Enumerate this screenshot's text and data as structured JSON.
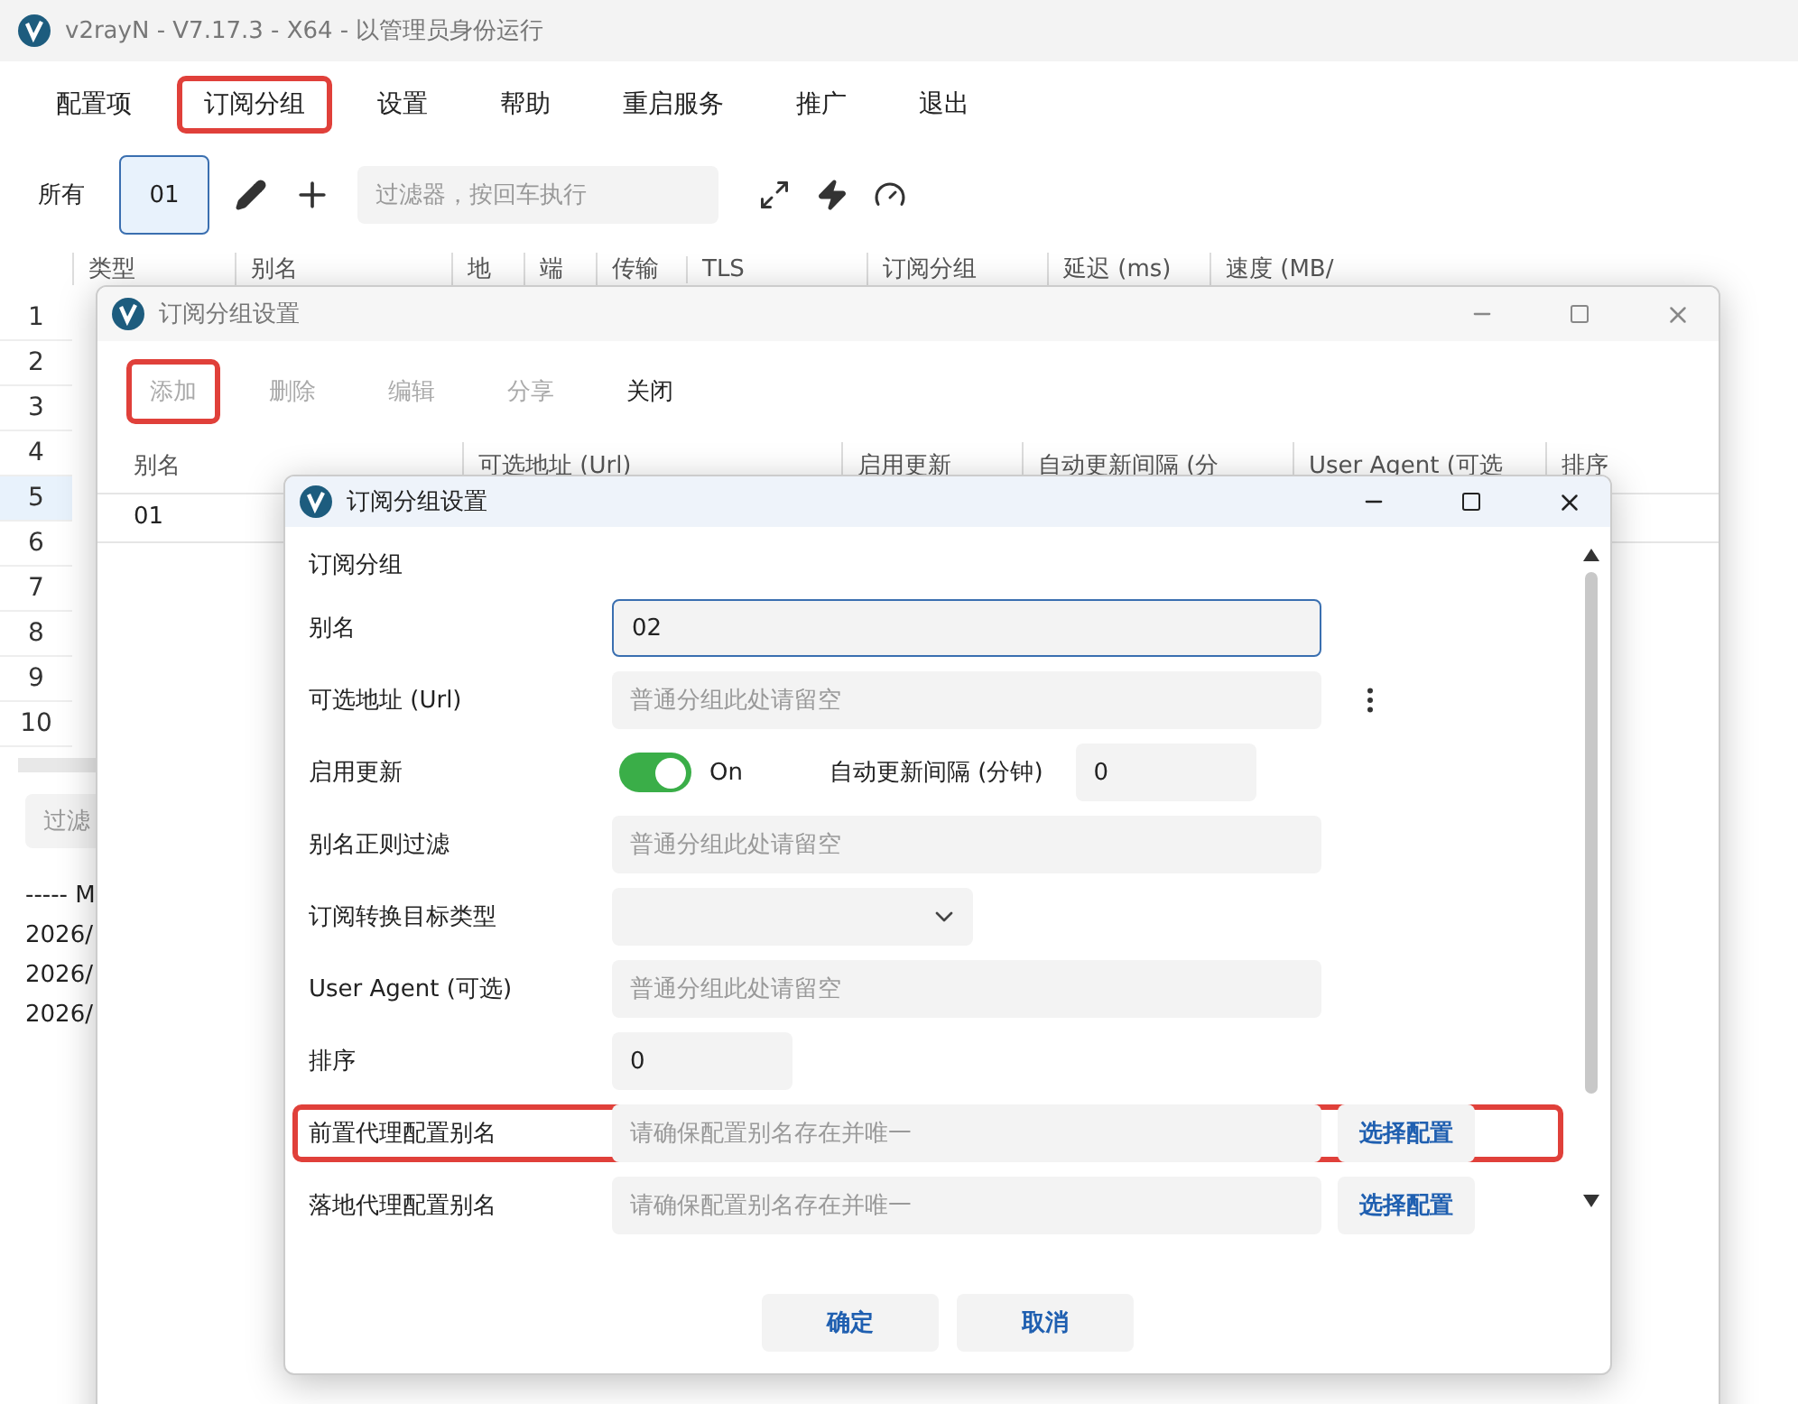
{
  "window": {
    "title": "v2rayN - V7.17.3 - X64 - 以管理员身份运行"
  },
  "menu": [
    {
      "label": "配置项",
      "highlighted": false
    },
    {
      "label": "订阅分组",
      "highlighted": true
    },
    {
      "label": "设置",
      "highlighted": false
    },
    {
      "label": "帮助",
      "highlighted": false
    },
    {
      "label": "重启服务",
      "highlighted": false
    },
    {
      "label": "推广",
      "highlighted": false
    },
    {
      "label": "退出",
      "highlighted": false
    }
  ],
  "groups": [
    {
      "label": "所有",
      "selected": false
    },
    {
      "label": "01",
      "selected": true
    }
  ],
  "filter": {
    "placeholder": "过滤器，按回车执行"
  },
  "table": {
    "columns": [
      "类型",
      "别名",
      "地",
      "端",
      "传输",
      "TLS",
      "订阅分组",
      "延迟 (ms)",
      "速度 (MB/"
    ],
    "rows": [
      {
        "number": "1",
        "selected": false
      },
      {
        "number": "2",
        "selected": false
      },
      {
        "number": "3",
        "selected": false
      },
      {
        "number": "4",
        "selected": false
      },
      {
        "number": "5",
        "selected": true
      },
      {
        "number": "6",
        "selected": false
      },
      {
        "number": "7",
        "selected": false
      },
      {
        "number": "8",
        "selected": false
      },
      {
        "number": "9",
        "selected": false
      },
      {
        "number": "10",
        "selected": false
      }
    ]
  },
  "log": {
    "filter_placeholder": "过滤",
    "lines": [
      "----- M",
      "2026/",
      "2026/",
      "2026/"
    ]
  },
  "group_dialog": {
    "title": "订阅分组设置",
    "toolbar": [
      {
        "label": "添加",
        "disabled": true,
        "highlighted": true
      },
      {
        "label": "删除",
        "disabled": true,
        "highlighted": false
      },
      {
        "label": "编辑",
        "disabled": true,
        "highlighted": false
      },
      {
        "label": "分享",
        "disabled": true,
        "highlighted": false
      },
      {
        "label": "关闭",
        "disabled": false,
        "highlighted": false
      }
    ],
    "columns": [
      "别名",
      "可选地址 (Url)",
      "启用更新",
      "自动更新间隔 (分",
      "User Agent (可选",
      "排序"
    ],
    "rows": [
      [
        "01"
      ]
    ]
  },
  "edit_dialog": {
    "title": "订阅分组设置",
    "section": "订阅分组",
    "fields": [
      {
        "kind": "text",
        "label": "别名",
        "value": "02",
        "focused": true,
        "highlighted": false
      },
      {
        "kind": "more",
        "label": "可选地址 (Url)",
        "placeholder": "普通分组此处请留空",
        "highlighted": false
      },
      {
        "kind": "toggle",
        "label": "启用更新",
        "on": true,
        "state_label": "On",
        "extra_label": "自动更新间隔 (分钟)",
        "extra_value": "0",
        "highlighted": false
      },
      {
        "kind": "text",
        "label": "别名正则过滤",
        "placeholder": "普通分组此处请留空",
        "highlighted": false
      },
      {
        "kind": "select",
        "label": "订阅转换目标类型",
        "highlighted": false
      },
      {
        "kind": "text",
        "label": "User Agent (可选)",
        "placeholder": "普通分组此处请留空",
        "highlighted": false
      },
      {
        "kind": "short",
        "label": "排序",
        "value": "0",
        "highlighted": false
      },
      {
        "kind": "pick",
        "label": "前置代理配置别名",
        "placeholder": "请确保配置别名存在并唯一",
        "button": "选择配置",
        "highlighted": true
      },
      {
        "kind": "pick",
        "label": "落地代理配置别名",
        "placeholder": "请确保配置别名存在并唯一",
        "button": "选择配置",
        "highlighted": false
      }
    ],
    "buttons": [
      "确定",
      "取消"
    ]
  }
}
